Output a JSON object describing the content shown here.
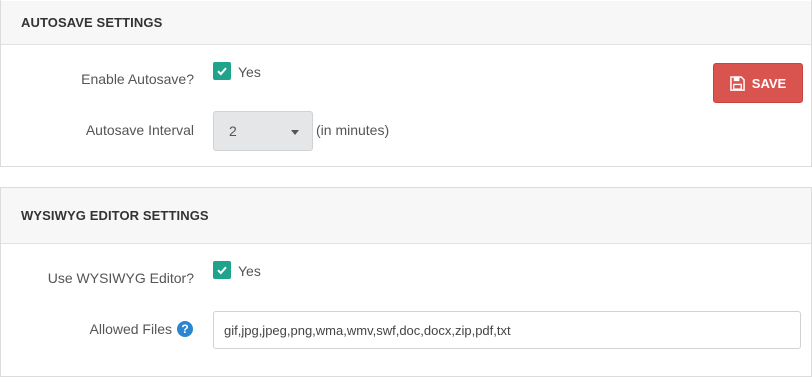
{
  "autosave": {
    "title": "AUTOSAVE SETTINGS",
    "enable_label": "Enable Autosave?",
    "enable_checked": true,
    "enable_value_text": "Yes",
    "interval_label": "Autosave Interval",
    "interval_value": "2",
    "interval_hint": "(in minutes)",
    "save_label": "SAVE"
  },
  "wysiwyg": {
    "title": "WYSIWYG EDITOR SETTINGS",
    "use_label": "Use WYSIWYG Editor?",
    "use_checked": true,
    "use_value_text": "Yes",
    "files_label": "Allowed Files",
    "files_value": "gif,jpg,jpeg,png,wma,wmv,swf,doc,docx,zip,pdf,txt",
    "help_glyph": "?"
  },
  "colors": {
    "check": "#1fa38a",
    "save_button": "#d9534f",
    "help": "#2a86d0"
  }
}
